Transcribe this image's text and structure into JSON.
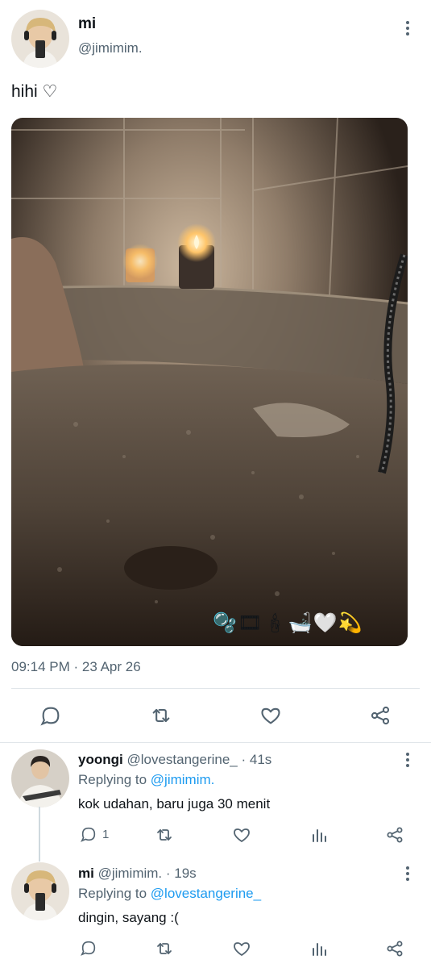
{
  "tweet": {
    "author_name": "mi",
    "author_handle": "@jimimim.",
    "text": "hihi ♡",
    "image_overlay_emoji": "🫧🎞🕯🛁🤍💫",
    "timestamp": "09:14 PM · 23 Apr 26",
    "actions": {
      "reply_icon": "reply-icon",
      "retweet_icon": "retweet-icon",
      "like_icon": "heart-icon",
      "share_icon": "share-icon"
    }
  },
  "replies": [
    {
      "author_name": "yoongi",
      "author_handle": "@lovestangerine_",
      "time": "· 41s",
      "replying_label": "Replying to",
      "replying_to": "@jimimim.",
      "text": "kok udahan, baru juga 30 menit",
      "reply_count": "1"
    },
    {
      "author_name": "mi",
      "author_handle": "@jimimim.",
      "time": "· 19s",
      "replying_label": "Replying to",
      "replying_to": "@lovestangerine_",
      "text": "dingin, sayang :(",
      "reply_count": ""
    }
  ],
  "colors": {
    "text_primary": "#0f1419",
    "text_secondary": "#536471",
    "link": "#1d9bf0",
    "divider": "#e1e6ea"
  }
}
